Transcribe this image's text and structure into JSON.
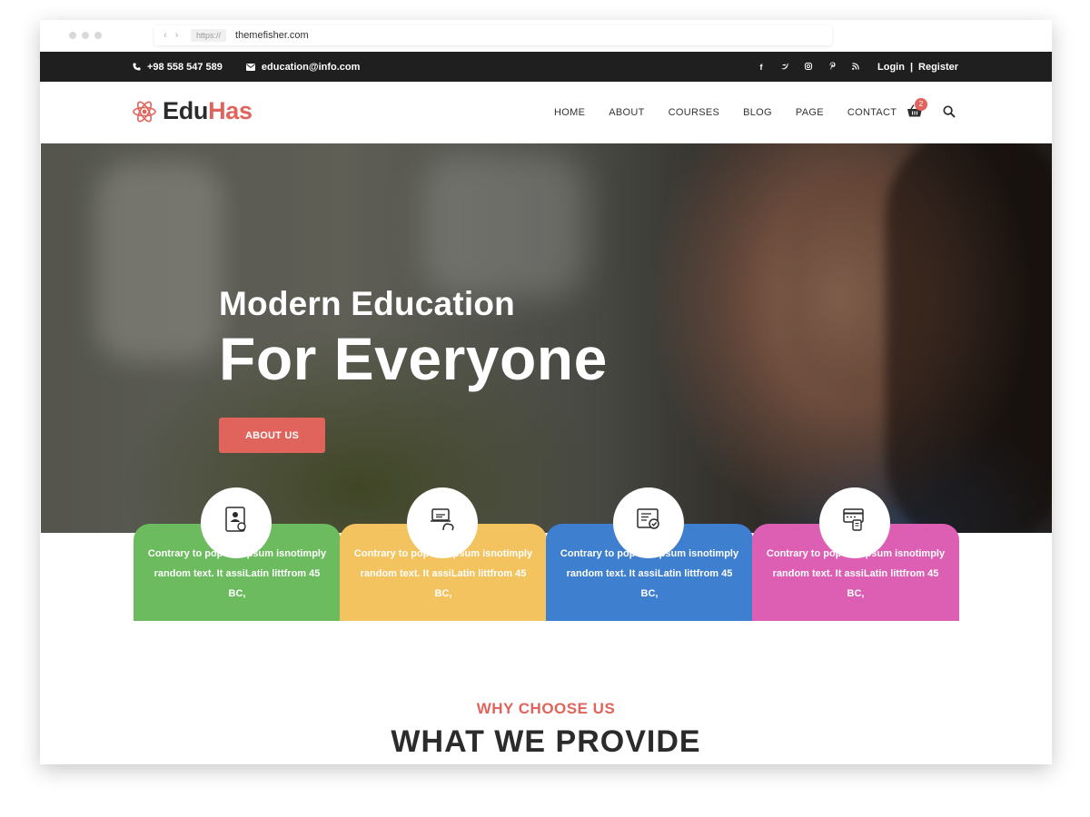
{
  "browser": {
    "scheme": "https://",
    "url": "themefisher.com"
  },
  "topbar": {
    "phone": "+98 558 547 589",
    "email": "education@info.com",
    "login": "Login",
    "separator": "|",
    "register": "Register",
    "social_icons": [
      "facebook-icon",
      "twitter-icon",
      "instagram-icon",
      "pinterest-icon",
      "rss-icon"
    ]
  },
  "logo": {
    "part1": "Edu",
    "part2": "Has"
  },
  "nav": {
    "items": [
      "HOME",
      "ABOUT",
      "COURSES",
      "BLOG",
      "PAGE",
      "CONTACT"
    ],
    "cart_count": "2"
  },
  "hero": {
    "line1": "Modern Education",
    "line2": "For Everyone",
    "button": "ABOUT US"
  },
  "features": [
    {
      "text": "Contrary to popular Ipsum isnotimply random text. It assiLatin littfrom 45 BC,",
      "color": "#6cbb5f",
      "icon": "certificate-icon"
    },
    {
      "text": "Contrary to popular Ipsum isnotimply random text. It assiLatin littfrom 45 BC,",
      "color": "#f2c35e",
      "icon": "laptop-hand-icon"
    },
    {
      "text": "Contrary to popular Ipsum isnotimply random text. It assiLatin littfrom 45 BC,",
      "color": "#3e7fcf",
      "icon": "diploma-icon"
    },
    {
      "text": "Contrary to popular Ipsum isnotimply random text. It assiLatin littfrom 45 BC,",
      "color": "#dc5fb3",
      "icon": "card-payment-icon"
    }
  ],
  "section": {
    "subtitle": "WHY CHOOSE US",
    "title": "WHAT WE PROVIDE"
  },
  "colors": {
    "accent": "#e0645c",
    "topbar": "#1f1f1f"
  }
}
